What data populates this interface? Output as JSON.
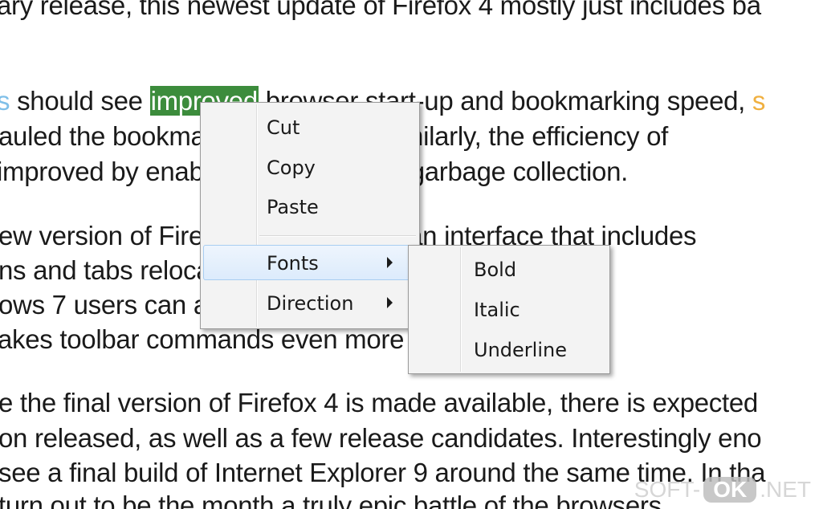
{
  "document": {
    "line1": "ary release, this newest update of Firefox 4 mostly just includes ba",
    "line2_prefix": "s",
    "line2_a": " should see ",
    "line2_selected": "improved",
    "line2_b": " browser start-up and bookmarking speed, ",
    "line2_suffix": "s",
    "line3": "auled the bookmarks sync code. Similarly, the efficiency of",
    "line4": "improved by enabling compartment garbage collection.",
    "line5": "ew version of Firefox 4 beta boasts an interface that includes",
    "line6": "ns and tabs relocated to the title bar. In addition, Wi",
    "line7": "ows 7 users can access a new menu on the top le",
    "line8": "akes toolbar commands even more accessible.",
    "line9": "e the final version of Firefox 4 is made available, there is expected",
    "line10": "on released, as well as a few release candidates. Interestingly eno",
    "line11": " see a final build of Internet Explorer 9 around the same time. In tha",
    "line12": " turn out to be the month a truly epic battle of the browsers."
  },
  "context_menu": {
    "items": [
      {
        "label": "Cut"
      },
      {
        "label": "Copy"
      },
      {
        "label": "Paste"
      },
      {
        "label": "Fonts"
      },
      {
        "label": "Direction"
      }
    ]
  },
  "fonts_submenu": {
    "items": [
      {
        "label": "Bold"
      },
      {
        "label": "Italic"
      },
      {
        "label": "Underline"
      }
    ]
  },
  "watermark": {
    "left": "SOFT-",
    "badge": "OK",
    "right": ".NET"
  },
  "colors": {
    "selection": "#3c8c3c",
    "menu_hover": "#dcebfc"
  }
}
